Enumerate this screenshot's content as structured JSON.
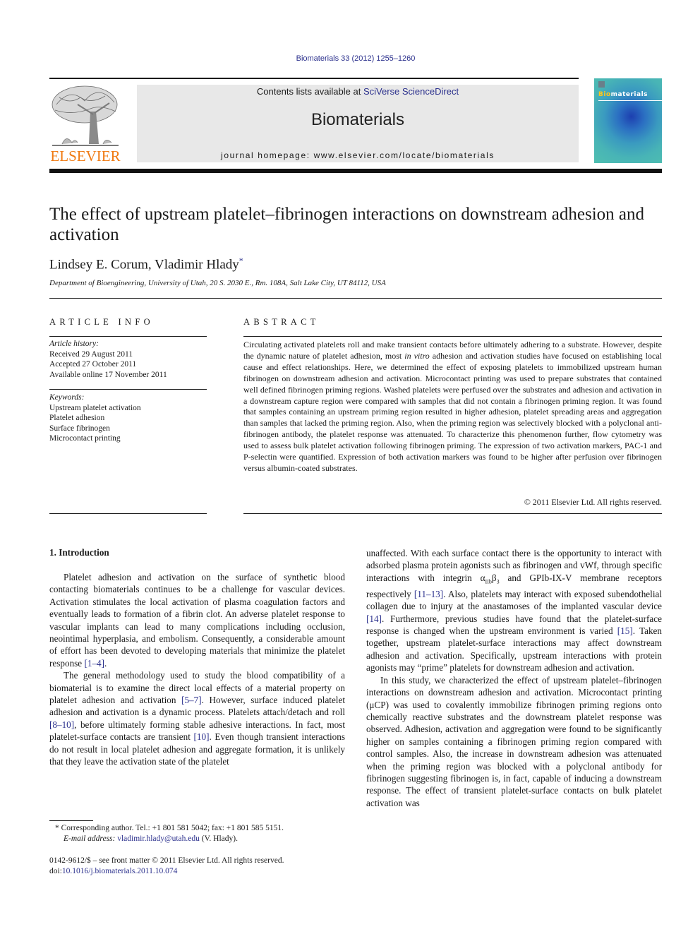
{
  "header": {
    "journal_ref": "Biomaterials 33 (2012) 1255–1260",
    "publisher_logo_text": "ELSEVIER",
    "contents_prefix": "Contents lists available at ",
    "contents_link": "SciVerse ScienceDirect",
    "journal_name": "Biomaterials",
    "homepage": "journal homepage: www.elsevier.com/locate/biomaterials",
    "cover": {
      "title_highlight": "Bio",
      "title_rest": "materials",
      "accent_color": "#ffc61a"
    },
    "colors": {
      "link": "#2a2f8c",
      "publisher_orange": "#f07a12",
      "banner_bg": "#e8e8e8"
    }
  },
  "article": {
    "title": "The effect of upstream platelet–fibrinogen interactions on downstream adhesion and activation",
    "authors": "Lindsey E. Corum, Vladimir Hlady",
    "author_mark": "*",
    "affiliation": "Department of Bioengineering, University of Utah, 20 S. 2030 E., Rm. 108A, Salt Lake City, UT 84112, USA"
  },
  "article_info": {
    "heading": "ARTICLE INFO",
    "history_label": "Article history:",
    "history": [
      "Received 29 August 2011",
      "Accepted 27 October 2011",
      "Available online 17 November 2011"
    ],
    "keywords_label": "Keywords:",
    "keywords": [
      "Upstream platelet activation",
      "Platelet adhesion",
      "Surface fibrinogen",
      "Microcontact printing"
    ]
  },
  "abstract": {
    "heading": "ABSTRACT",
    "text_part1": "Circulating activated platelets roll and make transient contacts before ultimately adhering to a substrate. However, despite the dynamic nature of platelet adhesion, most ",
    "text_italic": "in vitro",
    "text_part2": " adhesion and activation studies have focused on establishing local cause and effect relationships. Here, we determined the effect of exposing platelets to immobilized upstream human fibrinogen on downstream adhesion and activation. Microcontact printing was used to prepare substrates that contained well defined fibrinogen priming regions. Washed platelets were perfused over the substrates and adhesion and activation in a downstream capture region were compared with samples that did not contain a fibrinogen priming region. It was found that samples containing an upstream priming region resulted in higher adhesion, platelet spreading areas and aggregation than samples that lacked the priming region. Also, when the priming region was selectively blocked with a polyclonal anti-fibrinogen antibody, the platelet response was attenuated. To characterize this phenomenon further, flow cytometry was used to assess bulk platelet activation following fibrinogen priming. The expression of two activation markers, PAC-1 and P-selectin were quantified. Expression of both activation markers was found to be higher after perfusion over fibrinogen versus albumin-coated substrates.",
    "copyright": "© 2011 Elsevier Ltd. All rights reserved."
  },
  "body": {
    "section_heading": "1.  Introduction",
    "p1": {
      "a": "Platelet adhesion and activation on the surface of synthetic blood contacting biomaterials continues to be a challenge for vascular devices. Activation stimulates the local activation of plasma coagulation factors and eventually leads to formation of a fibrin clot. An adverse platelet response to vascular implants can lead to many complications including occlusion, neointimal hyperplasia, and embolism. Consequently, a considerable amount of effort has been devoted to developing materials that minimize the platelet response ",
      "ref1": "[1–4]",
      "b": "."
    },
    "p2": {
      "a": "The general methodology used to study the blood compatibility of a biomaterial is to examine the direct local effects of a material property on platelet adhesion and activation ",
      "ref1": "[5–7]",
      "b": ". However, surface induced platelet adhesion and activation is a dynamic process. Platelets attach/detach and roll ",
      "ref2": "[8–10]",
      "c": ", before ultimately forming stable adhesive interactions. In fact, most platelet-surface contacts are transient ",
      "ref3": "[10]",
      "d": ". Even though transient interactions do not result in local platelet adhesion and aggregate formation, it is unlikely that they leave the activation state of the platelet"
    },
    "p3": {
      "a": "unaffected. With each surface contact there is the opportunity to interact with adsorbed plasma protein agonists such as fibrinogen and vWf, through specific interactions with integrin α",
      "sub1": "IIb",
      "mid": "β",
      "sub2": "3",
      "b": " and GPIb-IX-V membrane receptors respectively ",
      "ref1": "[11–13]",
      "c": ". Also, platelets may interact with exposed subendothelial collagen due to injury at the anastamoses of the implanted vascular device ",
      "ref2": "[14]",
      "d": ". Furthermore, previous studies have found that the platelet-surface response is changed when the upstream environment is varied ",
      "ref3": "[15]",
      "e": ". Taken together, upstream platelet-surface interactions may affect downstream adhesion and activation. Specifically, upstream interactions with protein agonists may “prime” platelets for downstream adhesion and activation."
    },
    "p4": "In this study, we characterized the effect of upstream platelet–fibrinogen interactions on downstream adhesion and activation. Microcontact printing (μCP) was used to covalently immobilize fibrinogen priming regions onto chemically reactive substrates and the downstream platelet response was observed. Adhesion, activation and aggregation were found to be significantly higher on samples containing a fibrinogen priming region compared with control samples. Also, the increase in downstream adhesion was attenuated when the priming region was blocked with a polyclonal antibody for fibrinogen suggesting fibrinogen is, in fact, capable of inducing a downstream response. The effect of transient platelet-surface contacts on bulk platelet activation was"
  },
  "footnote": {
    "mark": "*",
    "corresponding": " Corresponding author. Tel.: +1 801 581 5042; fax: +1 801 585 5151.",
    "email_label": "E-mail address:",
    "email": "vladimir.hlady@utah.edu",
    "email_suffix": " (V. Hlady)."
  },
  "front_matter": {
    "issn_line": "0142-9612/$ – see front matter © 2011 Elsevier Ltd. All rights reserved.",
    "doi_label": "doi:",
    "doi": "10.1016/j.biomaterials.2011.10.074"
  }
}
